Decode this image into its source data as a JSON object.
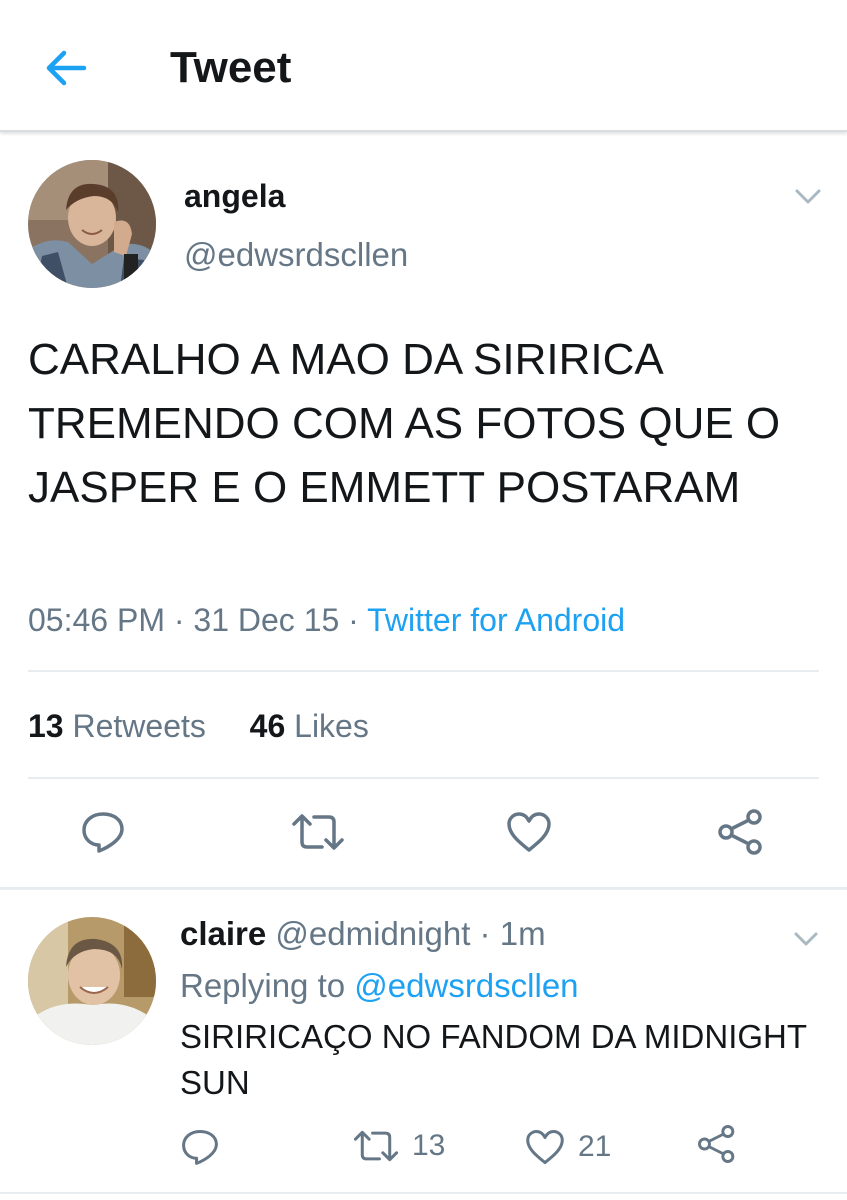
{
  "topbar": {
    "title": "Tweet"
  },
  "tweet": {
    "author_name": "angela",
    "author_handle": "@edwsrdscllen",
    "text": "CARALHO A MAO DA SIRIRICA TREMENDO COM AS FOTOS QUE O JASPER E O EMMETT POSTARAM",
    "time": "05:46 PM",
    "sep1": "·",
    "date": "31 Dec 15",
    "sep2": "·",
    "source": "Twitter for Android",
    "retweets_count": "13",
    "retweets_label": "Retweets",
    "likes_count": "46",
    "likes_label": "Likes"
  },
  "reply": {
    "author_name": "claire",
    "author_handle": "@edmidnight",
    "dot": "·",
    "time": "1m",
    "replying_prefix": "Replying to",
    "replying_to": "@edwsrdscllen",
    "text": "SIRIRICAÇO NO FANDOM DA MIDNIGHT SUN",
    "retweet_count": "13",
    "like_count": "21"
  },
  "colors": {
    "accent": "#1da1f2",
    "secondary_text": "#657786",
    "icon": "#657786",
    "divider": "#e6ecf0"
  },
  "icons": [
    "arrow-left-icon",
    "chevron-down-icon",
    "reply-icon",
    "retweet-icon",
    "heart-icon",
    "share-icon"
  ]
}
